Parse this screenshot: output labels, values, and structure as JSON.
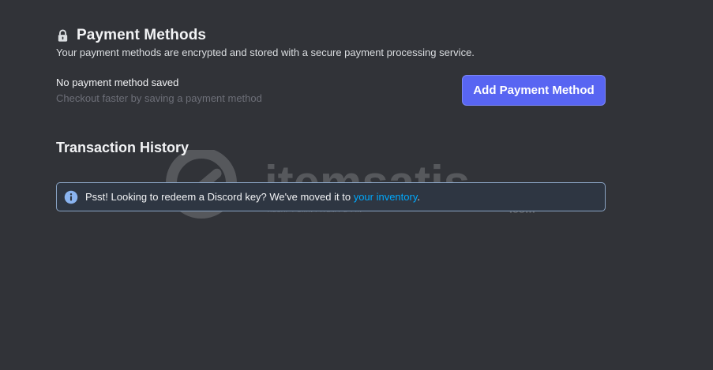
{
  "payment": {
    "title": "Payment Methods",
    "subtitle": "Your payment methods are encrypted and stored with a secure payment processing service.",
    "empty_title": "No payment method saved",
    "empty_subtitle": "Checkout faster by saving a payment method",
    "add_button_label": "Add Payment Method",
    "icon": "lock-icon"
  },
  "transactions": {
    "title": "Transaction History"
  },
  "notice": {
    "text_before": "Psst! Looking to redeem a Discord key? We've moved it to ",
    "link_text": "your inventory",
    "text_after": ".",
    "icon": "info-icon"
  },
  "watermark": {
    "brand": "itemsatis",
    "tld": ".com",
    "tagline": "HESAP / SKIN / ITEM / E-PIN"
  },
  "colors": {
    "background": "#313338",
    "accent": "#5865f2",
    "link": "#00a8fc",
    "info": "#5b8fd6"
  }
}
